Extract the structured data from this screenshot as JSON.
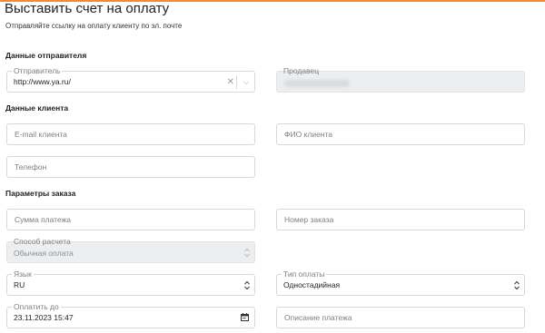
{
  "page": {
    "title": "Выставить счет на оплату",
    "subtitle": "Отправляйте ссылку на оплату клиенту по эл. почте",
    "accent_color": "#f08a3c"
  },
  "sender": {
    "section_title": "Данные отправителя",
    "sender_label": "Отправитель",
    "sender_value": "http://www.ya.ru/",
    "seller_label": "Продавец"
  },
  "client": {
    "section_title": "Данные клиента",
    "email_placeholder": "E-mail клиента",
    "name_placeholder": "ФИО клиента",
    "phone_placeholder": "Телефон"
  },
  "order": {
    "section_title": "Параметры заказа",
    "amount_placeholder": "Сумма платежа",
    "order_number_placeholder": "Номер заказа",
    "settlement_label": "Способ расчета",
    "settlement_value": "Обычная оплата",
    "language_label": "Язык",
    "language_value": "RU",
    "payment_type_label": "Тип оплаты",
    "payment_type_value": "Одностадийная",
    "pay_until_label": "Оплатить до",
    "pay_until_value": "23.11.2023 15:47",
    "description_placeholder": "Описание платежа"
  }
}
